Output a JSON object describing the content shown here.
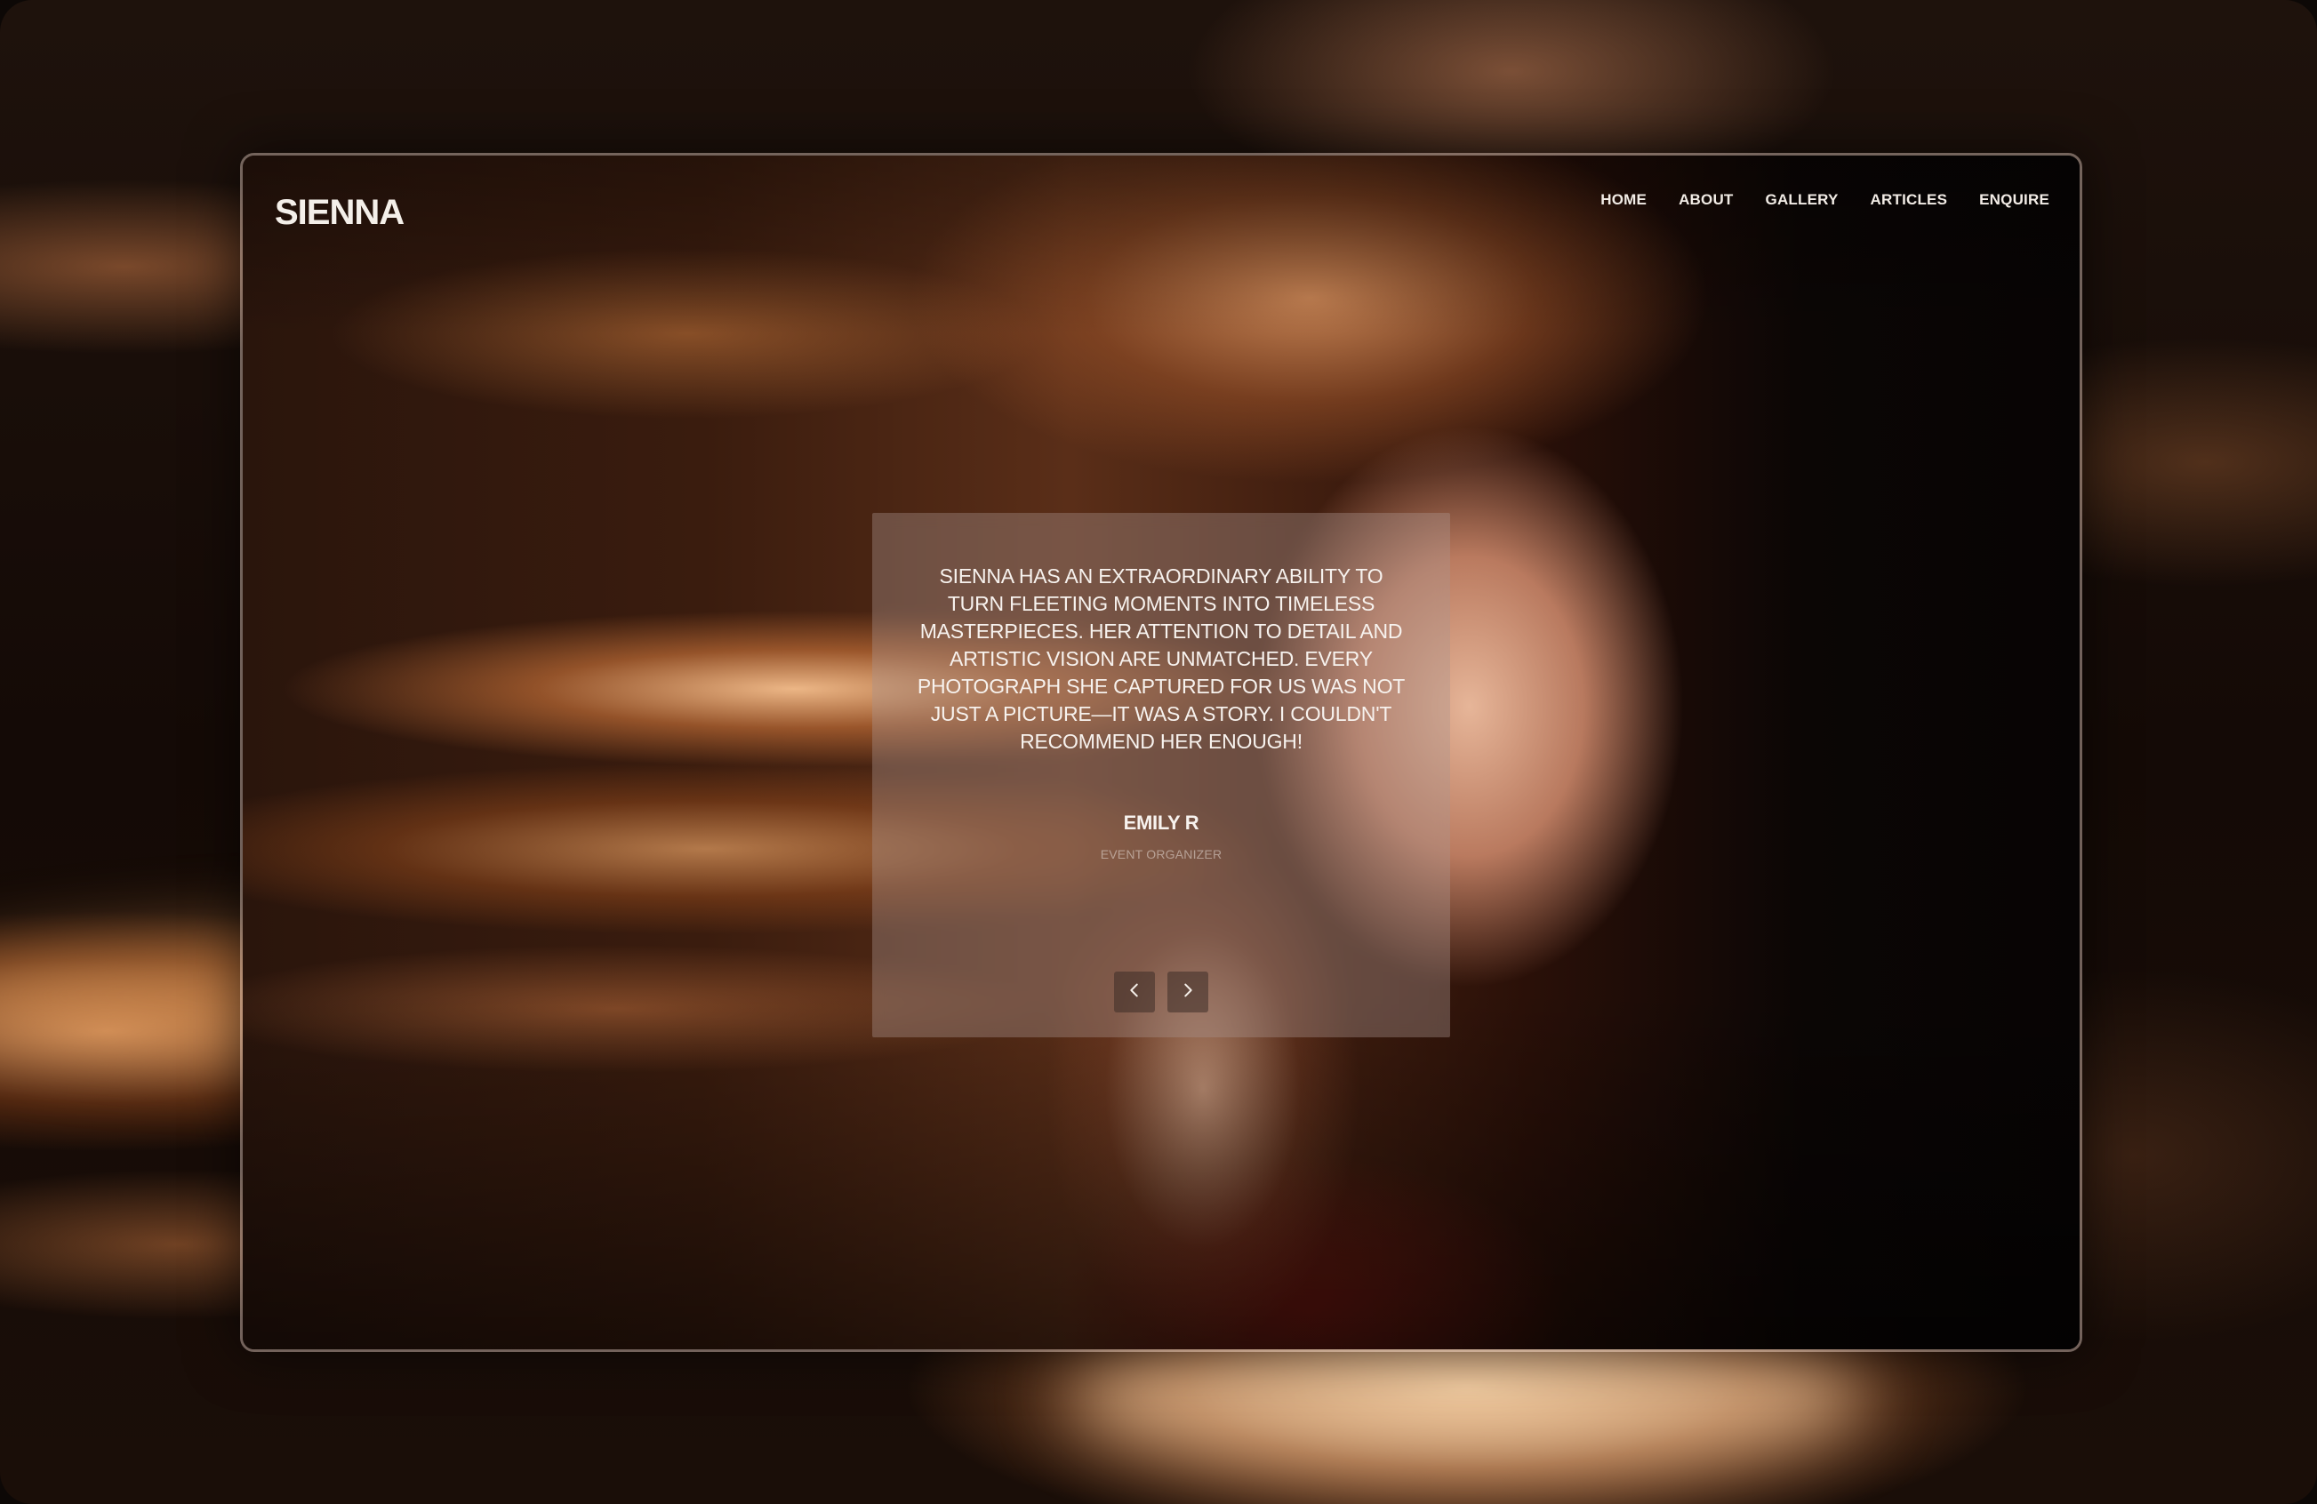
{
  "site": {
    "logo": "SIENNA"
  },
  "nav": {
    "items": [
      {
        "label": "HOME"
      },
      {
        "label": "ABOUT"
      },
      {
        "label": "GALLERY"
      },
      {
        "label": "ARTICLES"
      },
      {
        "label": "ENQUIRE"
      }
    ]
  },
  "testimonial": {
    "quote": "SIENNA HAS AN EXTRAORDINARY ABILITY TO TURN FLEETING MOMENTS INTO TIMELESS MASTERPIECES. HER ATTENTION TO DETAIL AND ARTISTIC VISION ARE UNMATCHED. EVERY PHOTOGRAPH SHE CAPTURED FOR US WAS NOT JUST A PICTURE—IT WAS A STORY. I COULDN'T RECOMMEND HER ENOUGH!",
    "author": "EMILY R",
    "role": "EVENT ORGANIZER"
  },
  "controls": {
    "prev_icon": "chevron-left-icon",
    "next_icon": "chevron-right-icon"
  }
}
